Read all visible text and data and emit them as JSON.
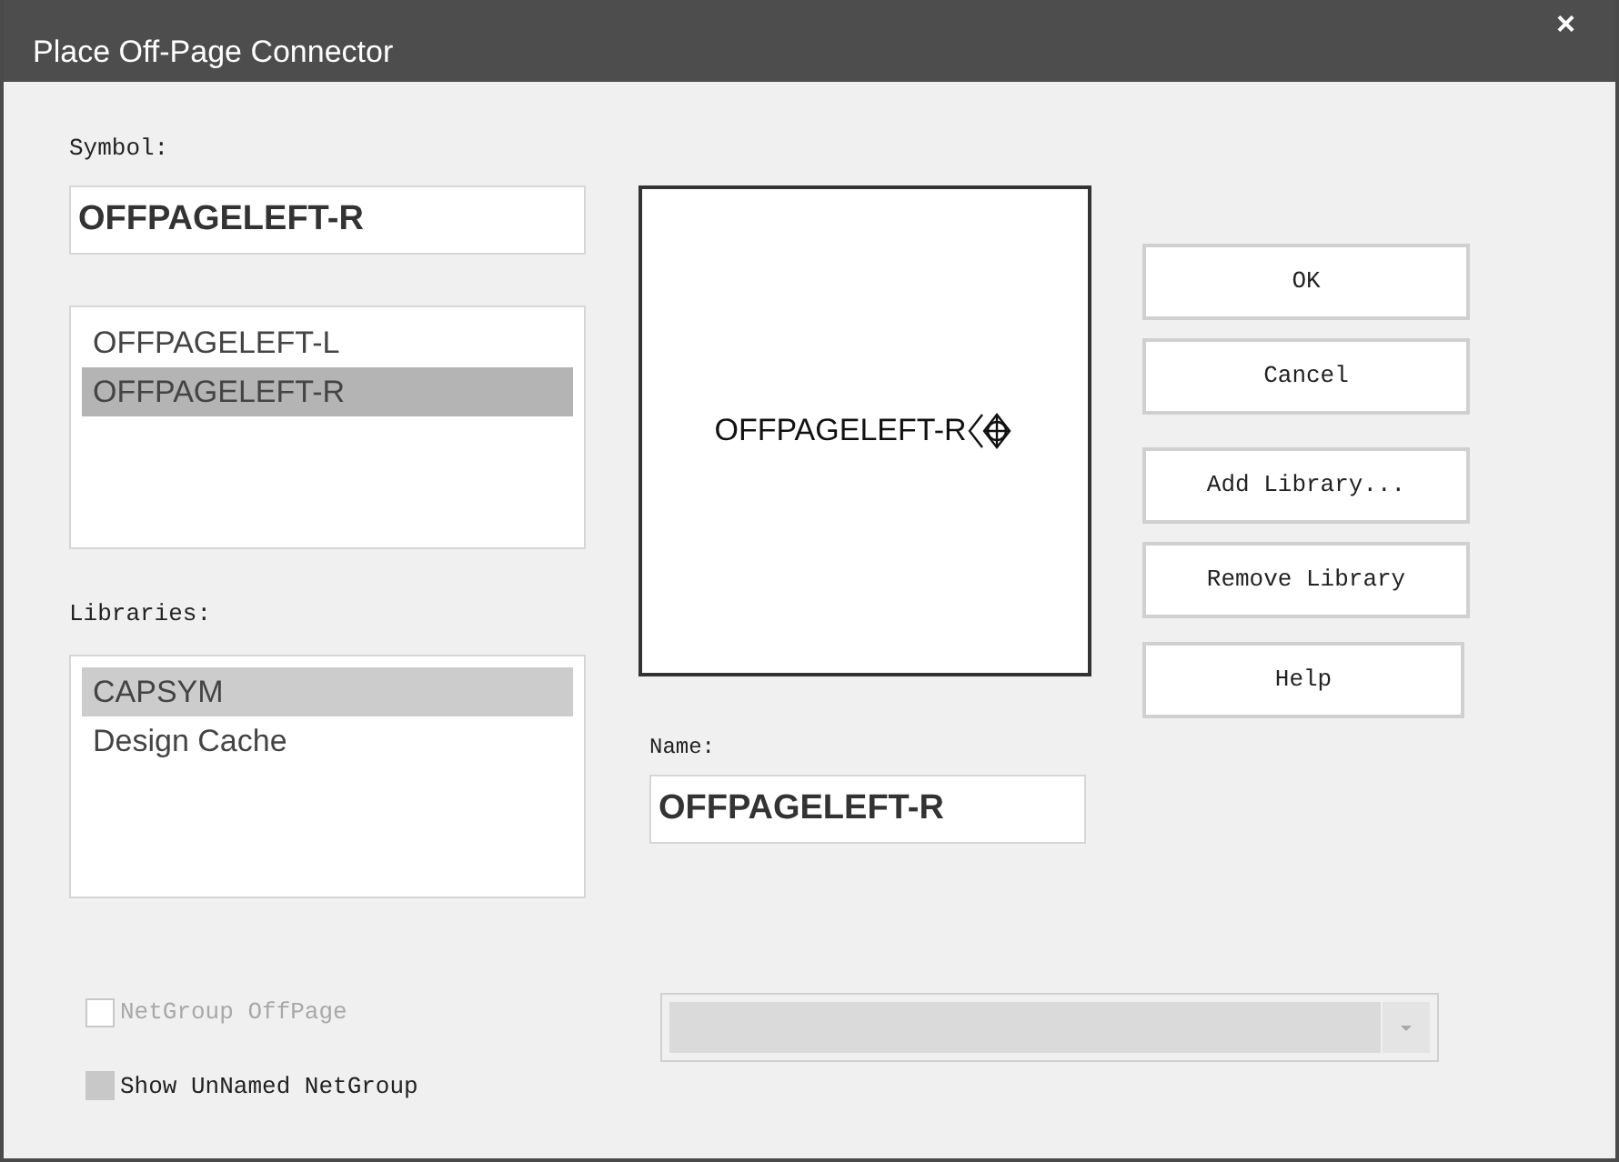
{
  "window": {
    "title": "Place Off-Page Connector",
    "close": "×"
  },
  "symbol": {
    "label": "Symbol:",
    "value": "OFFPAGELEFT-R"
  },
  "symbols": [
    {
      "label": "OFFPAGELEFT-L",
      "selected": false
    },
    {
      "label": "OFFPAGELEFT-R",
      "selected": true
    }
  ],
  "libraries_label": "Libraries:",
  "libraries": [
    {
      "label": "CAPSYM",
      "selected": true
    },
    {
      "label": "Design Cache",
      "selected": false
    }
  ],
  "preview": {
    "text": "OFFPAGELEFT-R"
  },
  "name": {
    "label": "Name:",
    "value": "OFFPAGELEFT-R"
  },
  "buttons": [
    {
      "label": "OK"
    },
    {
      "label": "Cancel"
    },
    {
      "label": "Add Library..."
    },
    {
      "label": "Remove Library"
    },
    {
      "label": "Help"
    }
  ],
  "checkboxes": [
    {
      "label": "NetGroup OffPage",
      "checked": false,
      "disabled": true,
      "indeterminate": false
    },
    {
      "label": "Show UnNamed NetGroup",
      "checked": false,
      "disabled": false,
      "indeterminate": true
    }
  ],
  "netgroup_combo": {
    "disabled": true
  }
}
